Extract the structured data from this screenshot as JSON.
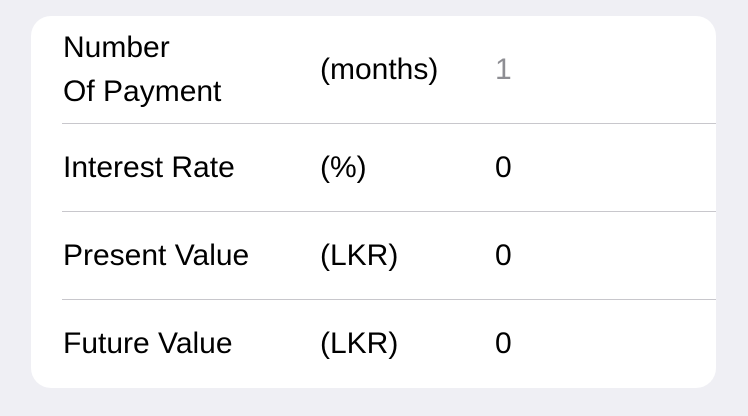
{
  "form": {
    "rows": [
      {
        "label": "Number\nOf Payment",
        "unit": "(months)",
        "value": "",
        "placeholder": "1"
      },
      {
        "label": "Interest Rate",
        "unit": "(%)",
        "value": "0",
        "placeholder": ""
      },
      {
        "label": "Present Value",
        "unit": "(LKR)",
        "value": "0",
        "placeholder": ""
      },
      {
        "label": "Future Value",
        "unit": "(LKR)",
        "value": "0",
        "placeholder": ""
      }
    ]
  },
  "colors": {
    "background": "#EFEFF4",
    "card": "#FFFFFF",
    "separator": "#C8C7CC",
    "placeholder": "#8E8E93"
  }
}
